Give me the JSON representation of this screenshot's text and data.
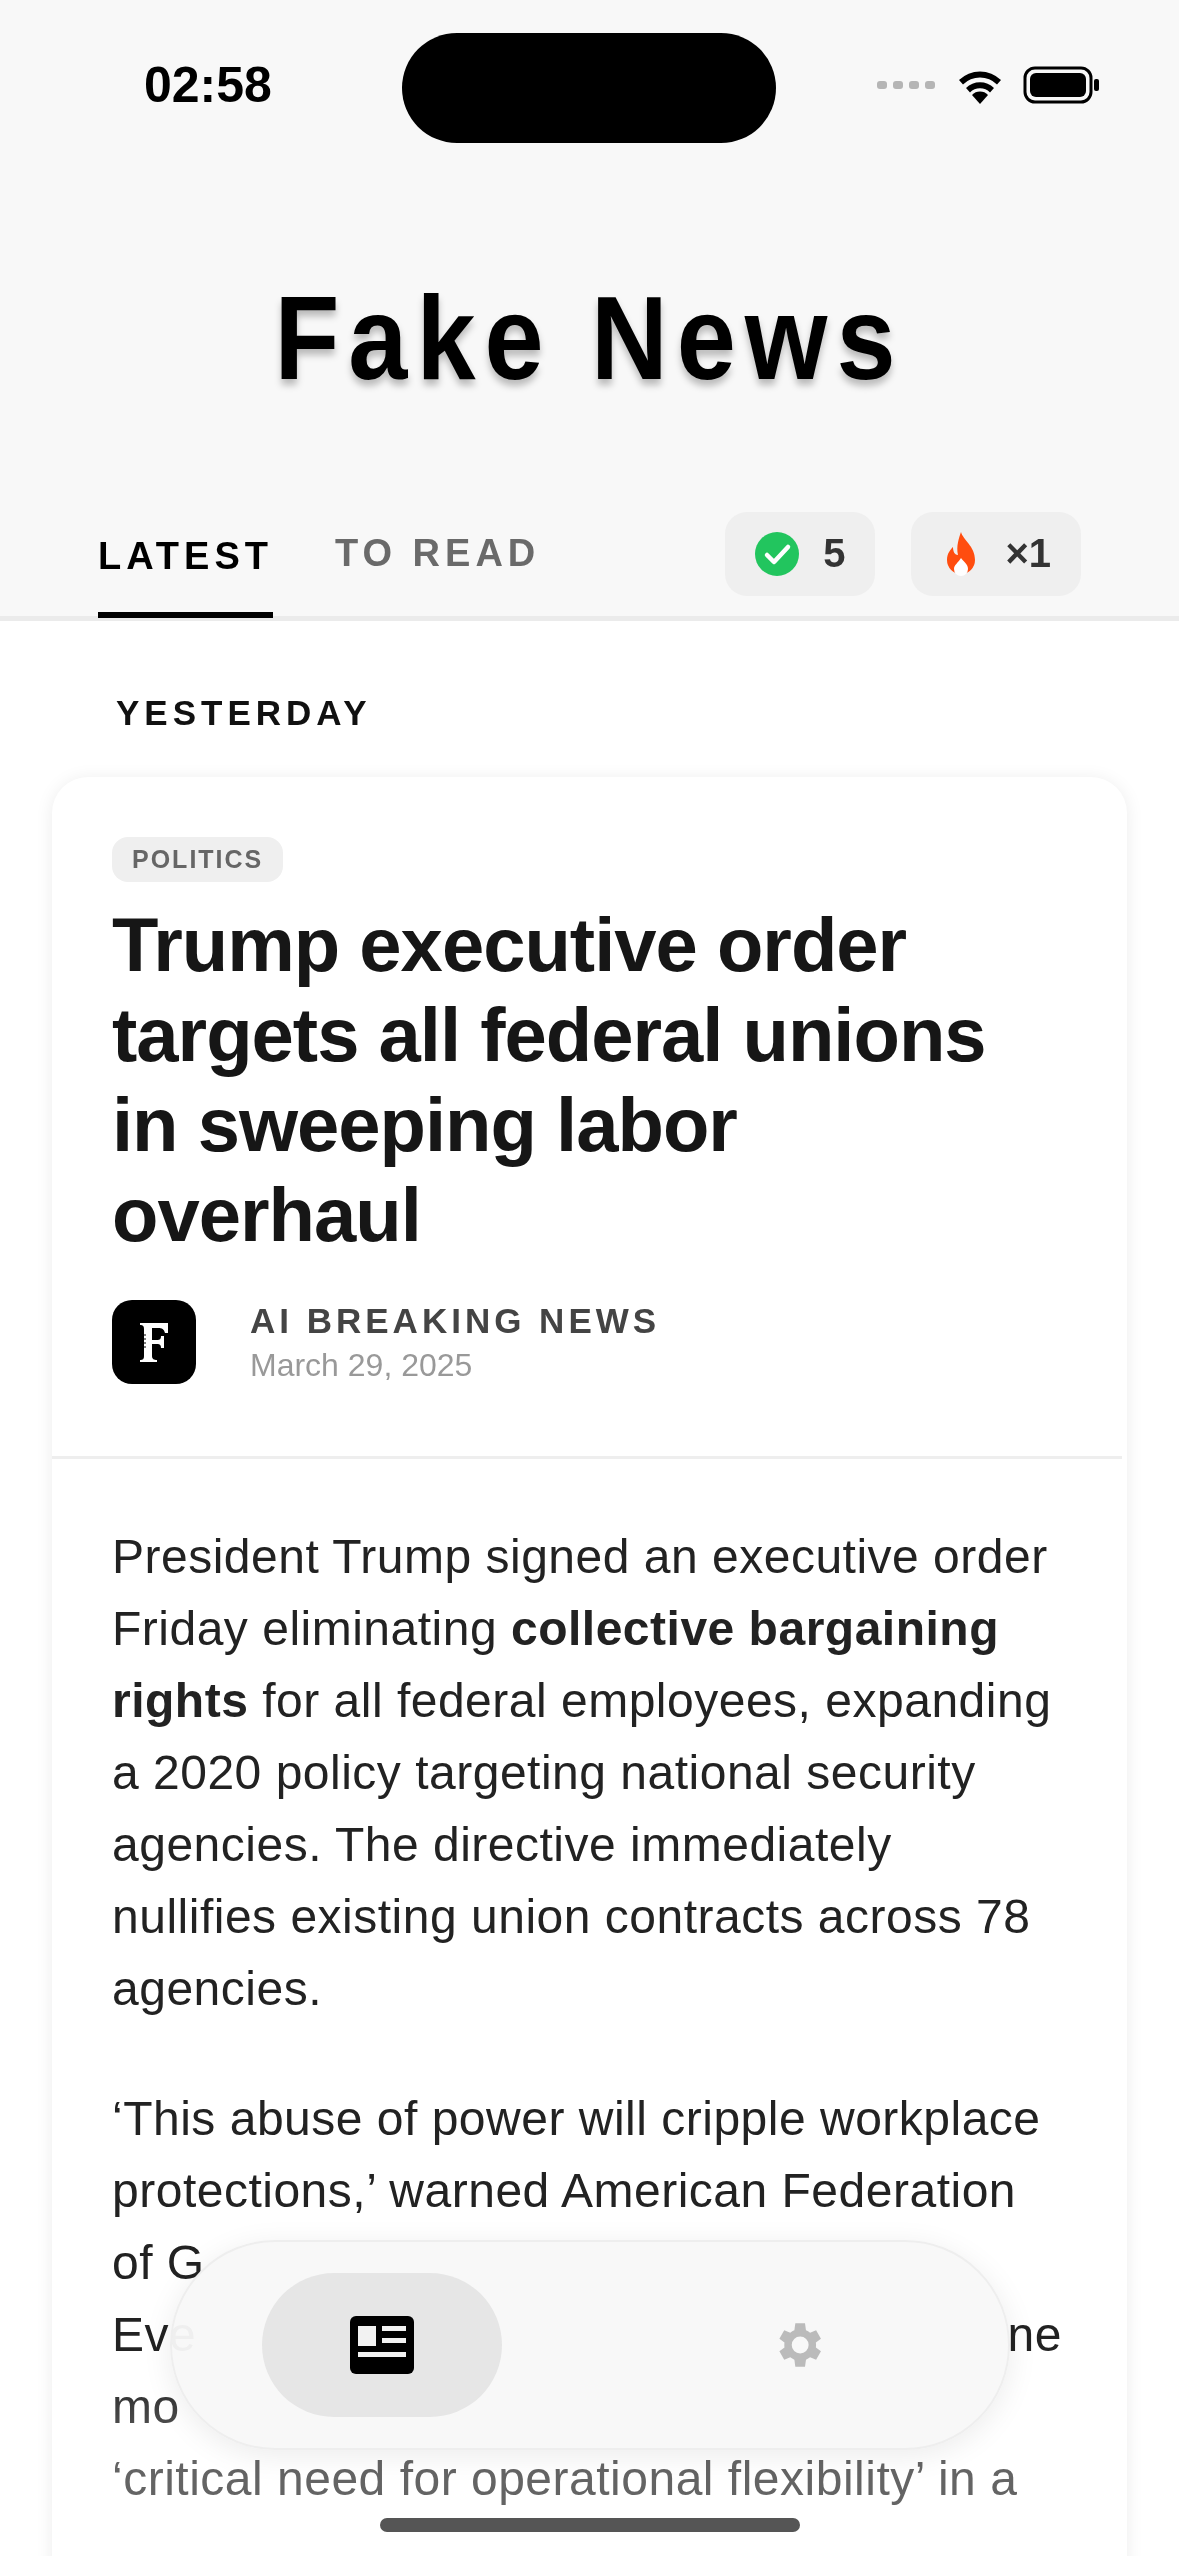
{
  "status_bar": {
    "time": "02:58"
  },
  "app_title": "Fake News",
  "tabs": [
    {
      "label": "LATEST",
      "selected": true
    },
    {
      "label": "TO READ",
      "selected": false
    }
  ],
  "badges": [
    {
      "kind": "check",
      "text": "5"
    },
    {
      "kind": "streak",
      "text": "×1"
    }
  ],
  "section_label": "YESTERDAY",
  "article": {
    "category": "POLITICS",
    "headline": "Trump executive order targets all federal unions in sweeping labor overhaul",
    "source": "AI BREAKING NEWS",
    "date": "March 29, 2025",
    "paragraphs": [
      "President Trump signed an executive order Friday eliminating **collective bargaining rights** for all federal employees, expanding a 2020 policy targeting national security agencies. The directive immediately nullifies existing union contracts across 78 agencies."
    ],
    "partial_lines": [
      {
        "text": "‘This abuse of power will cripple workplace"
      },
      {
        "text": "protections,’ warned American Federation"
      },
      {
        "text": "of G"
      },
      {
        "text": "Eve",
        "end_text": "ne"
      },
      {
        "text": "mo"
      },
      {
        "text": "‘critical need for operational flexibility’ in a"
      }
    ]
  },
  "bottom_nav": [
    {
      "kind": "news",
      "selected": true
    },
    {
      "kind": "settings",
      "selected": false
    }
  ]
}
